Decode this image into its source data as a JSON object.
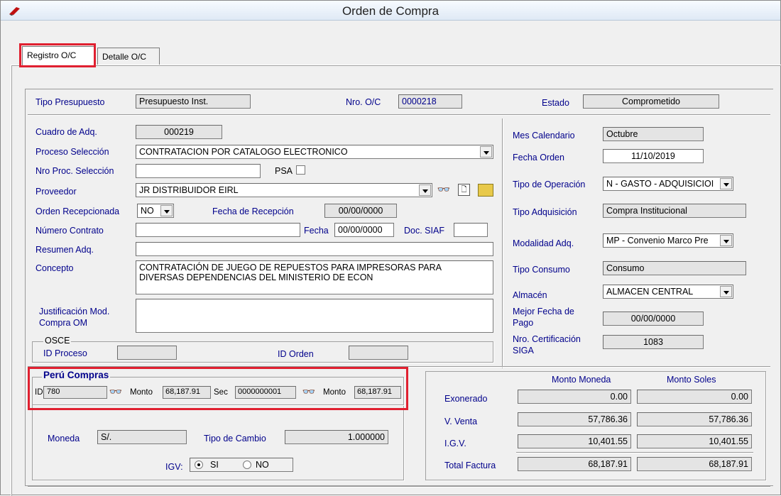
{
  "window": {
    "title": "Orden de Compra"
  },
  "tabs": [
    {
      "label": "Registro O/C"
    },
    {
      "label": "Detalle O/C"
    }
  ],
  "header": {
    "tipo_presupuesto": {
      "label": "Tipo Presupuesto",
      "value": "Presupuesto Inst."
    },
    "nro_oc": {
      "label": "Nro. O/C",
      "value": "0000218"
    },
    "estado": {
      "label": "Estado",
      "value": "Comprometido"
    }
  },
  "left": {
    "cuadro": {
      "label": "Cuadro de Adq.",
      "value": "000219"
    },
    "proceso": {
      "label": "Proceso Selección",
      "value": "CONTRATACION POR CATALOGO ELECTRONICO"
    },
    "nro_proc": {
      "label": "Nro Proc. Selección",
      "value": ""
    },
    "psa": {
      "label": "PSA"
    },
    "proveedor": {
      "label": "Proveedor",
      "value": "JR DISTRIBUIDOR EIRL"
    },
    "orden_recep": {
      "label": "Orden Recepcionada",
      "value": "NO"
    },
    "fecha_recep": {
      "label": "Fecha de Recepción",
      "value": "00/00/0000"
    },
    "numero_contrato": {
      "label": "Número Contrato",
      "value": ""
    },
    "fecha": {
      "label": "Fecha",
      "value": "00/00/0000"
    },
    "doc_siaf": {
      "label": "Doc. SIAF",
      "value": ""
    },
    "resumen": {
      "label": "Resumen Adq.",
      "value": ""
    },
    "concepto": {
      "label": "Concepto",
      "line1": "CONTRATACIÓN DE JUEGO DE REPUESTOS PARA IMPRESORAS PARA",
      "line2": "DIVERSAS DEPENDENCIAS DEL MINISTERIO DE ECON"
    },
    "justificacion": {
      "label1": "Justificación Mod.",
      "label2": "Compra OM",
      "value": ""
    }
  },
  "osce": {
    "title": "OSCE",
    "id_proceso": {
      "label": "ID Proceso",
      "value": ""
    },
    "id_orden": {
      "label": "ID Orden",
      "value": ""
    }
  },
  "right": {
    "mes": {
      "label": "Mes Calendario",
      "value": "Octubre"
    },
    "fecha_orden": {
      "label": "Fecha Orden",
      "value": "11/10/2019"
    },
    "tipo_operacion": {
      "label": "Tipo de Operación",
      "value": "N - GASTO - ADQUISICIOI"
    },
    "tipo_adq": {
      "label": "Tipo Adquisición",
      "value": "Compra Institucional"
    },
    "modalidad": {
      "label": "Modalidad Adq.",
      "value": "MP - Convenio Marco Pre"
    },
    "tipo_consumo": {
      "label": "Tipo Consumo",
      "value": "Consumo"
    },
    "almacen": {
      "label": "Almacén",
      "value": "ALMACEN CENTRAL"
    },
    "mejor_fecha": {
      "label1": "Mejor Fecha de",
      "label2": "Pago",
      "value": "00/00/0000"
    },
    "certificacion": {
      "label1": "Nro. Certificación",
      "label2": "SIGA",
      "value": "1083"
    }
  },
  "peru_compras": {
    "title": "Perú Compras",
    "id_label": "ID",
    "id_value": "780",
    "monto_label": "Monto",
    "monto1": "68,187.91",
    "sec_label": "Sec",
    "sec_value": "0000000001",
    "monto2": "68,187.91"
  },
  "moneda": {
    "label": "Moneda",
    "value": "S/.",
    "tc_label": "Tipo de Cambio",
    "tc_value": "1.000000",
    "igv_label": "IGV:",
    "si": "SI",
    "no": "NO"
  },
  "totals": {
    "col_moneda": "Monto Moneda",
    "col_soles": "Monto Soles",
    "rows": [
      {
        "label": "Exonerado",
        "moneda": "0.00",
        "soles": "0.00"
      },
      {
        "label": "V. Venta",
        "moneda": "57,786.36",
        "soles": "57,786.36"
      },
      {
        "label": "I.G.V.",
        "moneda": "10,401.55",
        "soles": "10,401.55"
      },
      {
        "label": "Total Factura",
        "moneda": "68,187.91",
        "soles": "68,187.91"
      }
    ]
  },
  "colors": {
    "label_blue": "#00008b",
    "highlight_red": "#e02030"
  }
}
